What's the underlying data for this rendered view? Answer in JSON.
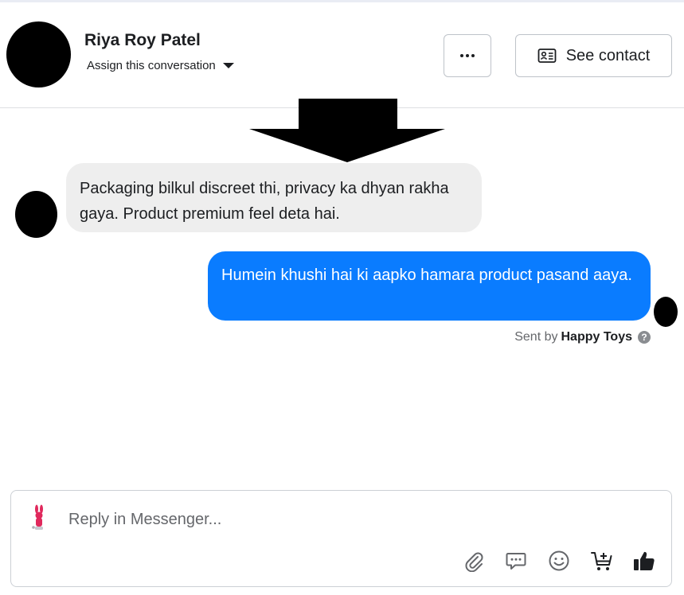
{
  "header": {
    "contact_name": "Riya Roy Patel",
    "assign_label": "Assign this conversation",
    "more_button_icon": "more-horizontal-icon",
    "see_contact_label": "See contact",
    "see_contact_icon": "contact-card-icon"
  },
  "messages": [
    {
      "direction": "incoming",
      "text": "Packaging bilkul discreet thi, privacy ka dhyan rakha gaya. Product premium feel deta hai."
    },
    {
      "direction": "outgoing",
      "text": "Humein khushi hai ki aapko hamara product pasand aaya."
    }
  ],
  "sent_by": {
    "prefix": "Sent by",
    "page_name": "Happy Toys"
  },
  "composer": {
    "placeholder": "Reply in Messenger...",
    "tools": [
      "paperclip-icon",
      "saved-reply-icon",
      "emoji-icon",
      "add-to-cart-icon",
      "thumbs-up-icon"
    ]
  },
  "colors": {
    "outgoing_bubble": "#0a7cff",
    "incoming_bubble": "#eeeeee",
    "muted_text": "#65676b"
  }
}
